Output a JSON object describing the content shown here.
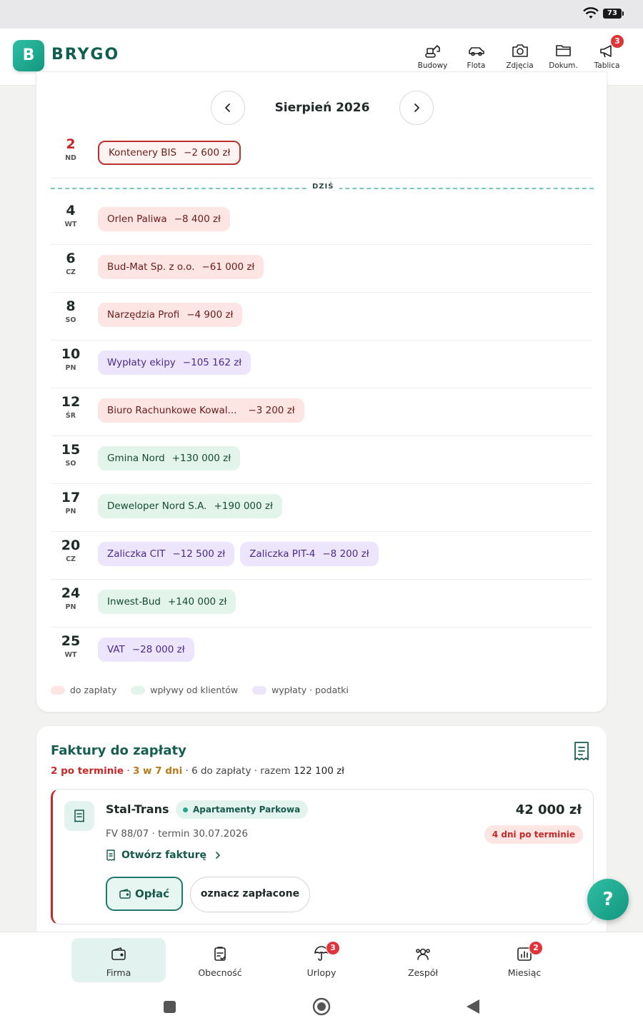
{
  "status": {
    "battery": "73"
  },
  "brand": {
    "letter": "B",
    "name": "BRYGO"
  },
  "nav_top": [
    {
      "label": "Budowy",
      "icon": "excavator-icon"
    },
    {
      "label": "Flota",
      "icon": "car-icon"
    },
    {
      "label": "Zdjęcia",
      "icon": "camera-icon"
    },
    {
      "label": "Dokum.",
      "icon": "folder-icon"
    },
    {
      "label": "Tablica",
      "icon": "megaphone-icon",
      "badge": "3"
    }
  ],
  "calendar": {
    "month": "Sierpień 2026",
    "today_label": "DZIŚ",
    "rows": [
      {
        "day": "2",
        "weekday": "ND",
        "events": [
          {
            "name": "Kontenery BIS",
            "amount": "−2 600 zł",
            "type": "outlined"
          }
        ]
      },
      {
        "day": "4",
        "weekday": "WT",
        "events": [
          {
            "name": "Orlen Paliwa",
            "amount": "−8 400 zł",
            "type": "red"
          }
        ]
      },
      {
        "day": "6",
        "weekday": "CZ",
        "events": [
          {
            "name": "Bud-Mat Sp. z o.o.",
            "amount": "−61 000 zł",
            "type": "red"
          }
        ]
      },
      {
        "day": "8",
        "weekday": "SO",
        "events": [
          {
            "name": "Narzędzia Profi",
            "amount": "−4 900 zł",
            "type": "red"
          }
        ]
      },
      {
        "day": "10",
        "weekday": "PN",
        "events": [
          {
            "name": "Wypłaty ekipy",
            "amount": "−105 162 zł",
            "type": "purple"
          }
        ]
      },
      {
        "day": "12",
        "weekday": "ŚR",
        "events": [
          {
            "name": "Biuro Rachunkowe Kowal...",
            "amount": "−3 200 zł",
            "type": "red"
          }
        ]
      },
      {
        "day": "15",
        "weekday": "SO",
        "events": [
          {
            "name": "Gmina Nord",
            "amount": "+130 000 zł",
            "type": "green"
          }
        ]
      },
      {
        "day": "17",
        "weekday": "PN",
        "events": [
          {
            "name": "Deweloper Nord S.A.",
            "amount": "+190 000 zł",
            "type": "green"
          }
        ]
      },
      {
        "day": "20",
        "weekday": "CZ",
        "events": [
          {
            "name": "Zaliczka CIT",
            "amount": "−12 500 zł",
            "type": "purple"
          },
          {
            "name": "Zaliczka PIT-4",
            "amount": "−8 200 zł",
            "type": "purple"
          }
        ]
      },
      {
        "day": "24",
        "weekday": "PN",
        "events": [
          {
            "name": "Inwest-Bud",
            "amount": "+140 000 zł",
            "type": "green"
          }
        ]
      },
      {
        "day": "25",
        "weekday": "WT",
        "events": [
          {
            "name": "VAT",
            "amount": "−28 000 zł",
            "type": "purple"
          }
        ]
      }
    ],
    "legend": [
      {
        "label": "do zapłaty",
        "color": "#fde5e4"
      },
      {
        "label": "wpływy od klientów",
        "color": "#e3f4ea"
      },
      {
        "label": "wypłaty · podatki",
        "color": "#ede5fb"
      }
    ]
  },
  "invoices": {
    "title": "Faktury do zapłaty",
    "overdue_count": "2 po terminie",
    "sep1": " · ",
    "soon_count": "3 w 7 dni",
    "sep2": " · 6 do zapłaty · razem ",
    "total": "122 100 zł",
    "item": {
      "vendor": "Stal-Trans",
      "project": "Apartamenty Parkowa",
      "meta": "FV 88/07 · termin 30.07.2026",
      "amount": "42 000 zł",
      "overdue": "4 dni po terminie",
      "open_label": "Otwórz fakturę",
      "pay_label": "Opłać",
      "mark_label": "oznacz zapłacone"
    }
  },
  "help": {
    "label": "?"
  },
  "bottom_nav": [
    {
      "label": "Firma",
      "icon": "wallet-icon",
      "active": true
    },
    {
      "label": "Obecność",
      "icon": "clipboard-check-icon"
    },
    {
      "label": "Urlopy",
      "icon": "umbrella-icon",
      "badge": "3"
    },
    {
      "label": "Zespół",
      "icon": "team-icon"
    },
    {
      "label": "Miesiąc",
      "icon": "chart-icon",
      "badge": "2"
    }
  ],
  "colors": {
    "accent": "#13977f",
    "danger": "#c62828",
    "brand_dark": "#125e51"
  }
}
